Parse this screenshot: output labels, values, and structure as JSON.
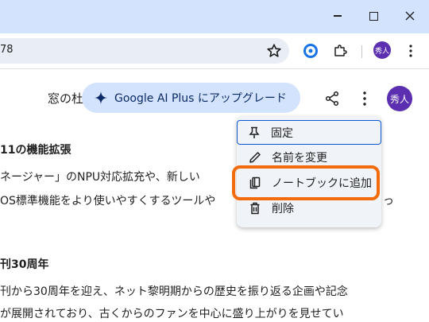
{
  "browser": {
    "url": "78",
    "profile_initial": "秀人"
  },
  "page": {
    "doc_title": "窓の杜",
    "upgrade_label": "Google AI Plus にアップグレード",
    "avatar_initial": "秀人",
    "lines": {
      "l1": "11の機能拡張",
      "l2": "ネージャー」のNPU対応拡充や、新しい",
      "l3": "OS標準機能をより使いやすくするツールや",
      "l3b": "っ",
      "l4": "刊30周年",
      "l5": "刊から30周年を迎え、ネット黎明期からの歴史を振り返る企画や記念",
      "l6": "が展開されており、古くからのファンを中心に盛り上がりを見せてい"
    }
  },
  "menu": {
    "pin": "固定",
    "rename": "名前を変更",
    "add_to_notebook": "ノートブックに追加",
    "delete": "削除"
  },
  "colors": {
    "titlebar": "#d3e3fd",
    "accent": "#0b57d0",
    "highlight": "#f26c0d",
    "avatar": "#5b2fb0"
  }
}
